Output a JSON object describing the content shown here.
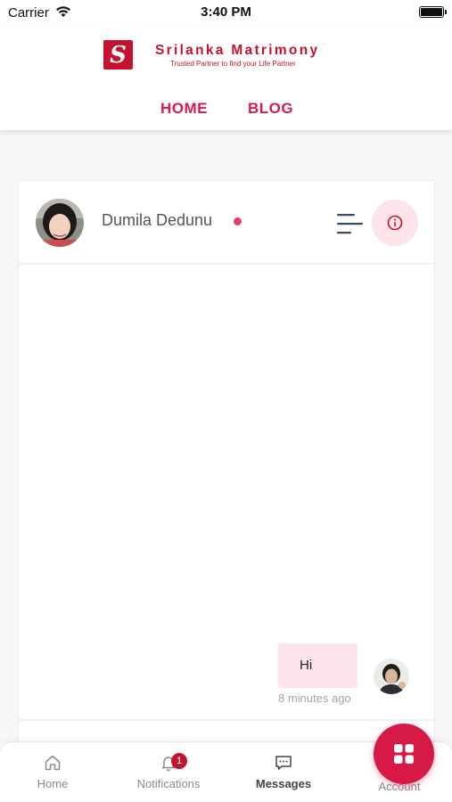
{
  "status_bar": {
    "carrier": "Carrier",
    "time": "3:40 PM"
  },
  "header": {
    "logo_letter": "S",
    "brand_name": "Srilanka Matrimony",
    "tagline": "Trusted Partner to find your Life Partner",
    "nav": [
      {
        "label": "HOME"
      },
      {
        "label": "BLOG"
      }
    ]
  },
  "chat": {
    "contact_name": "Dumila Dedunu",
    "online": true,
    "messages": [
      {
        "text": "Hi",
        "time": "8 minutes ago",
        "from": "me"
      }
    ]
  },
  "tab_bar": {
    "tabs": [
      {
        "label": "Home",
        "icon": "home-icon"
      },
      {
        "label": "Notifications",
        "icon": "bell-icon",
        "badge": "1"
      },
      {
        "label": "Messages",
        "icon": "chat-icon",
        "active": true
      },
      {
        "label": "Account",
        "icon": "grid-icon"
      }
    ]
  },
  "colors": {
    "brand": "#c4122f",
    "accent": "#d81b4f",
    "bubble": "#fde3ea",
    "online": "#e2406a"
  }
}
